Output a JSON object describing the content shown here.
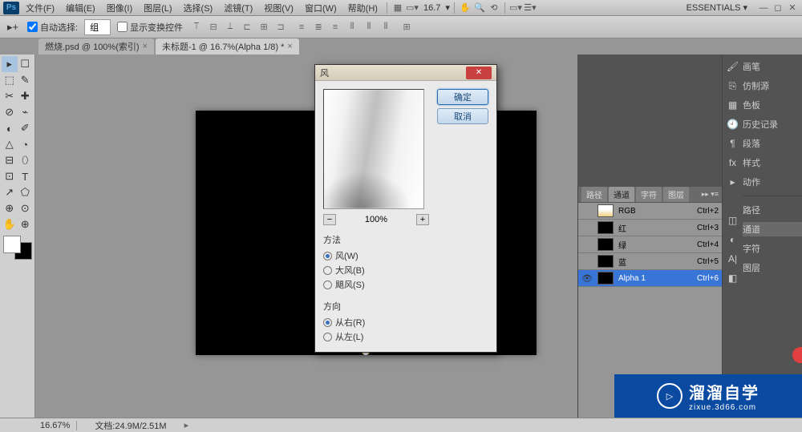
{
  "menubar": {
    "items": [
      "文件(F)",
      "编辑(E)",
      "图像(I)",
      "图层(L)",
      "选择(S)",
      "滤镜(T)",
      "视图(V)",
      "窗口(W)",
      "帮助(H)"
    ],
    "zoom": "16.7",
    "essentials": "ESSENTIALS ▾"
  },
  "options": {
    "auto_select": "自动选择:",
    "group_dropdown": "组",
    "show_transform": "显示变换控件"
  },
  "tabs": [
    {
      "label": "燃烧.psd @ 100%(索引)",
      "close": "×"
    },
    {
      "label": "未标题-1 @ 16.7%(Alpha 1/8) *",
      "close": "×"
    }
  ],
  "tools": [
    [
      "▸",
      "☐"
    ],
    [
      "⬚",
      "✎"
    ],
    [
      "✂",
      "✚"
    ],
    [
      "⊘",
      "⌁"
    ],
    [
      "◐",
      "✐"
    ],
    [
      "△",
      "◔"
    ],
    [
      "⊟",
      "⬯"
    ],
    [
      "⊡",
      "⊡"
    ],
    [
      "◑",
      "T"
    ],
    [
      "↗",
      "⬠"
    ],
    [
      "⊕",
      "⊙"
    ],
    [
      "✋",
      "⊕"
    ]
  ],
  "dialog": {
    "title": "风",
    "zoom": "100%",
    "ok": "确定",
    "cancel": "取消",
    "method_title": "方法",
    "methods": [
      {
        "label": "风(W)",
        "checked": true
      },
      {
        "label": "大风(B)",
        "checked": false
      },
      {
        "label": "飓风(S)",
        "checked": false
      }
    ],
    "direction_title": "方向",
    "directions": [
      {
        "label": "从右(R)",
        "checked": true
      },
      {
        "label": "从左(L)",
        "checked": false
      }
    ]
  },
  "channels": {
    "tabs": [
      "路径",
      "通道",
      "字符",
      "图层"
    ],
    "active_tab": "通道",
    "items": [
      {
        "label": "RGB",
        "key": "Ctrl+2",
        "eye": false
      },
      {
        "label": "红",
        "key": "Ctrl+3",
        "eye": false
      },
      {
        "label": "绿",
        "key": "Ctrl+4",
        "eye": false
      },
      {
        "label": "蓝",
        "key": "Ctrl+5",
        "eye": false
      },
      {
        "label": "Alpha 1",
        "key": "Ctrl+6",
        "eye": true,
        "sel": true
      }
    ]
  },
  "sidepanel": {
    "top": [
      {
        "icon": "🖌",
        "label": "画笔"
      },
      {
        "icon": "⎘",
        "label": "仿制源"
      },
      {
        "icon": "▦",
        "label": "色板"
      },
      {
        "icon": "🕘",
        "label": "历史记录"
      },
      {
        "icon": "¶",
        "label": "段落"
      },
      {
        "icon": "fx",
        "label": "样式"
      },
      {
        "icon": "▸",
        "label": "动作"
      }
    ],
    "bottom": [
      {
        "icon": "◫",
        "label": "路径"
      },
      {
        "icon": "◐",
        "label": "通道",
        "sel": true
      },
      {
        "icon": "A|",
        "label": "字符"
      },
      {
        "icon": "◧",
        "label": "图层"
      }
    ]
  },
  "status": {
    "zoom": "16.67%",
    "doc": "文档:24.9M/2.51M"
  },
  "watermark": {
    "brand": "溜溜自学",
    "sub": "zixue.3d66.com"
  }
}
